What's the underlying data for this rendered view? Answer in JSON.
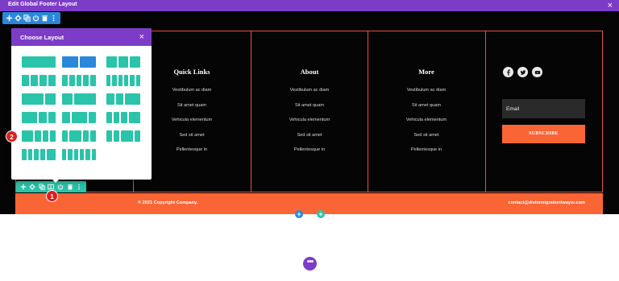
{
  "window": {
    "title": "Edit Global Footer Layout",
    "close_glyph": "×"
  },
  "section_toolbar": {
    "icons": [
      "plus-icon",
      "gear-icon",
      "duplicate-icon",
      "power-icon",
      "trash-icon",
      "more-vertical-icon"
    ]
  },
  "row_toolbar": {
    "icons": [
      "plus-icon",
      "gear-icon",
      "duplicate-icon",
      "columns-icon",
      "power-icon",
      "trash-icon",
      "more-vertical-icon"
    ]
  },
  "modal": {
    "title": "Choose Layout",
    "close_glyph": "×",
    "selected_index": 1,
    "layout_columns": [
      [
        1
      ],
      [
        1,
        1
      ],
      [
        1,
        1,
        1
      ],
      [
        1,
        1,
        1,
        1
      ],
      [
        1,
        1,
        1,
        1,
        1
      ],
      [
        1,
        1,
        1,
        1,
        1,
        1
      ],
      [
        2,
        1
      ],
      [
        1,
        2
      ],
      [
        1,
        1,
        2
      ],
      [
        2,
        1,
        1
      ],
      [
        1,
        2,
        1
      ],
      [
        1,
        1,
        1,
        2
      ],
      [
        2,
        1,
        1,
        1
      ],
      [
        1,
        2,
        1,
        1
      ],
      [
        1,
        1,
        2,
        1
      ],
      [
        1,
        1,
        1,
        1,
        2
      ],
      [
        1,
        1,
        1,
        1,
        1,
        1
      ]
    ]
  },
  "columns": [
    {
      "title": "Quick Links",
      "links": [
        "Vestibulum ac diam",
        "Sit amet quam",
        "Vehicula elementum",
        "Sed sit amet",
        "Pellentesque in"
      ]
    },
    {
      "title": "About",
      "links": [
        "Vestibulum ac diam",
        "Sit amet quam",
        "Vehicula elementum",
        "Sed sit amet",
        "Pellentesque in"
      ]
    },
    {
      "title": "More",
      "links": [
        "Vestibulum ac diam",
        "Sit amet quam",
        "Vehicula elementum",
        "Sed sit amet",
        "Pellentesque in"
      ]
    }
  ],
  "social": {
    "icons": [
      "facebook-icon",
      "twitter-icon",
      "youtube-icon"
    ]
  },
  "subscribe": {
    "email_placeholder": "Email",
    "button_label": "SUBSCRIBE"
  },
  "copyright": {
    "left": "© 2021 Copyright Company.",
    "right": "contact@divimmigrationlwayer.com"
  },
  "markers": {
    "one": "1",
    "two": "2"
  },
  "add_buttons": {
    "plus": "+",
    "more": "•••"
  },
  "colors": {
    "purple": "#7d3cc8",
    "blue": "#2b87da",
    "green": "#29c4a9",
    "orange": "#fa6535",
    "red_outline": "#e2533a",
    "marker_red": "#dd1e1e"
  }
}
